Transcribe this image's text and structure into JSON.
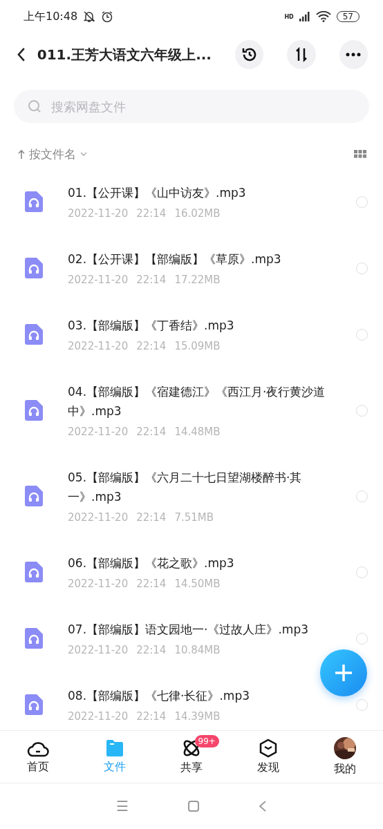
{
  "status_bar": {
    "time": "上午10:48",
    "signal_label": "HD",
    "battery": "57"
  },
  "header": {
    "title": "011.王芳大语文六年级上..."
  },
  "search": {
    "placeholder": "搜索网盘文件"
  },
  "sort": {
    "label": "按文件名"
  },
  "files": [
    {
      "name": "01.【公开课】《山中访友》.mp3",
      "date": "2022-11-20",
      "time": "22:14",
      "size": "16.02MB",
      "selected": false
    },
    {
      "name": "02.【公开课】【部编版】《草原》.mp3",
      "date": "2022-11-20",
      "time": "22:14",
      "size": "17.22MB",
      "selected": false
    },
    {
      "name": "03.【部编版】《丁香结》.mp3",
      "date": "2022-11-20",
      "time": "22:14",
      "size": "15.09MB",
      "selected": false
    },
    {
      "name": "04.【部编版】《宿建德江》《西江月·夜行黄沙道中》.mp3",
      "date": "2022-11-20",
      "time": "22:14",
      "size": "14.48MB",
      "selected": false
    },
    {
      "name": "05.【部编版】《六月二十七日望湖楼醉书·其一》.mp3",
      "date": "2022-11-20",
      "time": "22:14",
      "size": "7.51MB",
      "selected": false
    },
    {
      "name": "06.【部编版】《花之歌》.mp3",
      "date": "2022-11-20",
      "time": "22:14",
      "size": "14.50MB",
      "selected": false
    },
    {
      "name": "07.【部编版】语文园地一·《过故人庄》.mp3",
      "date": "2022-11-20",
      "time": "22:14",
      "size": "10.84MB",
      "selected": false
    },
    {
      "name": "08.【部编版】《七律·长征》.mp3",
      "date": "2022-11-20",
      "time": "22:14",
      "size": "14.39MB",
      "selected": false
    }
  ],
  "tabs": [
    {
      "label": "首页",
      "kind": "home",
      "selected": false
    },
    {
      "label": "文件",
      "kind": "files",
      "selected": true
    },
    {
      "label": "共享",
      "kind": "share",
      "selected": false,
      "badge": "99+"
    },
    {
      "label": "发现",
      "kind": "discover",
      "selected": false
    },
    {
      "label": "我的",
      "kind": "me",
      "selected": false
    }
  ],
  "system_nav": {
    "menu": "☰"
  }
}
